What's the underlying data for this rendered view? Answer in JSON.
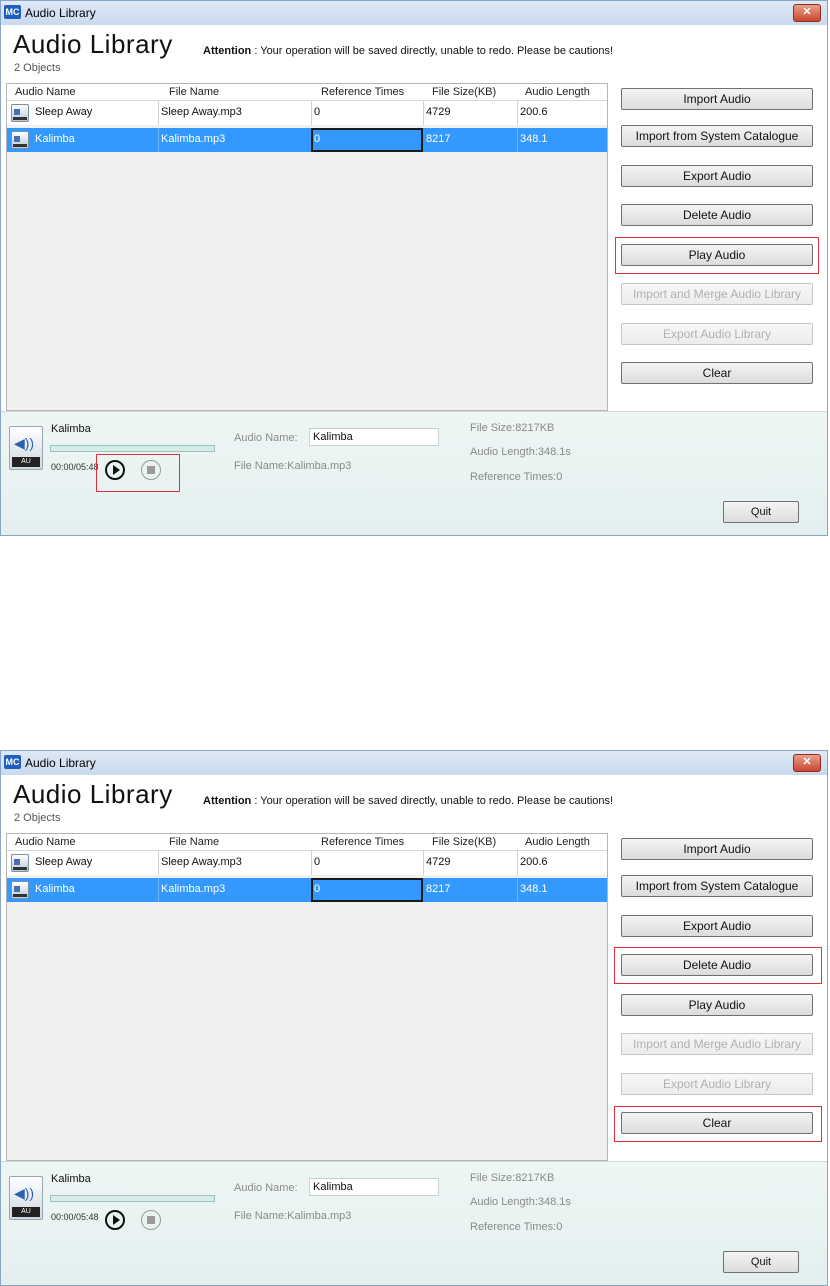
{
  "window": {
    "app_icon_text": "MC",
    "title": "Audio Library",
    "close_symbol": "✕"
  },
  "header": {
    "title": "Audio Library",
    "object_count": "2 Objects",
    "attention_label": "Attention",
    "attention_text": " : Your operation will be saved directly, unable to redo. Please be cautions!"
  },
  "table": {
    "columns": [
      "Audio Name",
      "File Name",
      "Reference Times",
      "File Size(KB)",
      "Audio Length"
    ],
    "rows": [
      {
        "audio_name": "Sleep Away",
        "file_name": "Sleep Away.mp3",
        "reference_times": "0",
        "file_size": "4729",
        "audio_length": "200.6"
      },
      {
        "audio_name": "Kalimba",
        "file_name": "Kalimba.mp3",
        "reference_times": "0",
        "file_size": "8217",
        "audio_length": "348.1"
      }
    ],
    "selected_row": 1
  },
  "buttons": {
    "import_audio": "Import Audio",
    "import_catalogue": "Import from System Catalogue",
    "export_audio": "Export Audio",
    "delete_audio": "Delete Audio",
    "play_audio": "Play Audio",
    "import_merge": "Import and Merge Audio Library",
    "export_library": "Export Audio Library",
    "clear": "Clear",
    "quit": "Quit"
  },
  "player": {
    "track_name": "Kalimba",
    "time": "00:00/05:48",
    "icon_tag": "AU",
    "icons": [
      "audio-file-icon",
      "play-icon",
      "stop-icon"
    ],
    "audio_name_label": "Audio Name:",
    "audio_name_value": "Kalimba",
    "file_name_text": "File Name:Kalimba.mp3",
    "file_size_text": "File Size:8217KB",
    "audio_length_text": "Audio Length:348.1s",
    "reference_times_text": "Reference Times:0"
  },
  "highlight_color": "#e0303a",
  "selection_color": "#3399ff"
}
